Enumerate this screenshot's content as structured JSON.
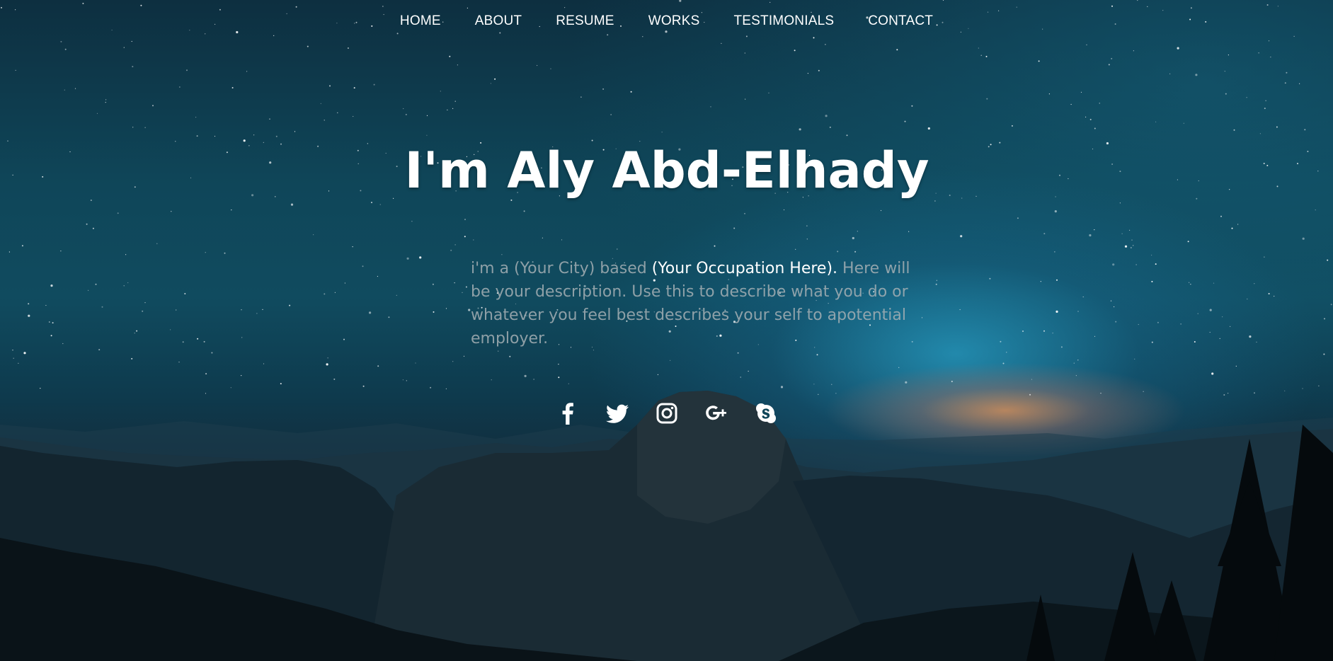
{
  "nav": {
    "items": [
      {
        "label": "HOME"
      },
      {
        "label": "ABOUT"
      },
      {
        "label": "RESUME"
      },
      {
        "label": "WORKS"
      },
      {
        "label": "TESTIMONIALS"
      },
      {
        "label": "CONTACT"
      }
    ]
  },
  "hero": {
    "title": "I'm Aly Abd-Elhady",
    "description_prefix": "i'm a (Your City) based ",
    "occupation": "(Your Occupation Here).",
    "description_suffix": " Here will be your description. Use this to describe what you do or whatever you feel best describes your self to apotential employer."
  },
  "social": {
    "icons": [
      "facebook-icon",
      "twitter-icon",
      "instagram-icon",
      "google-plus-icon",
      "skype-icon"
    ]
  },
  "colors": {
    "text": "#ffffff",
    "description": "#a5afb4",
    "sky_top": "#0d2f40",
    "sky_mid": "#104b5f",
    "glow": "#28a0c8",
    "horizon_orange": "#d28c5a"
  }
}
